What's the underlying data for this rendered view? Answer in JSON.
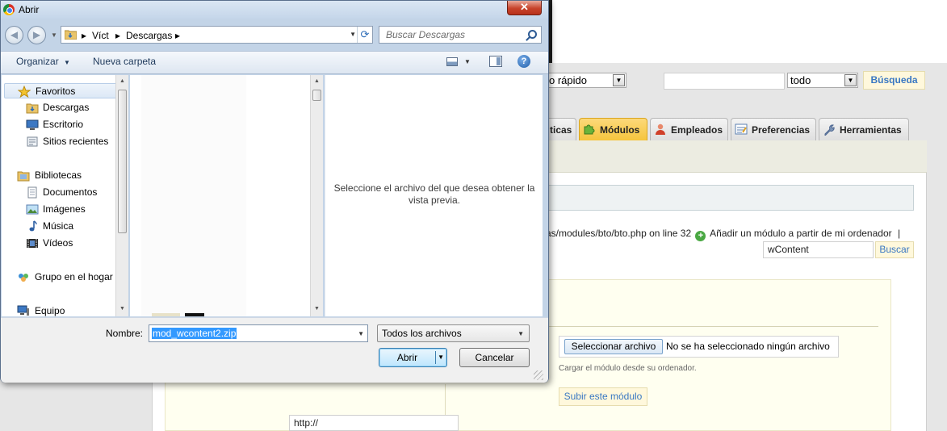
{
  "background_page": {
    "search_mode_select": "o rápido",
    "search_scope_select": "todo",
    "search_button": "Búsqueda",
    "tabs": [
      {
        "label": "ticas",
        "icon": "stats-icon",
        "active": false
      },
      {
        "label": "Módulos",
        "icon": "puzzle-icon",
        "active": true
      },
      {
        "label": "Empleados",
        "icon": "employee-icon",
        "active": false
      },
      {
        "label": "Preferencias",
        "icon": "preferences-icon",
        "active": false
      },
      {
        "label": "Herramientas",
        "icon": "wrench-icon",
        "active": false
      }
    ],
    "error_line_text": "as/modules/bto/bto.php on line 32",
    "add_module_link": "Añadir un módulo a partir de mi ordenador",
    "separator": "|",
    "module_search_value": "wContent",
    "module_search_button": "Buscar",
    "file_select_button": "Seleccionar archivo",
    "file_select_status": "No se ha seleccionado ningún archivo",
    "upload_hint": "Cargar el módulo desde su ordenador.",
    "upload_button": "Subir este módulo",
    "url_field_value": "http://",
    "colors": {
      "active_tab": "#f5c43b",
      "link_blue": "#3a78c3",
      "button_bg": "#fff8dc"
    }
  },
  "dialog": {
    "title": "Abrir",
    "close_label": "✕",
    "breadcrumb": [
      "Víct",
      "Descargas"
    ],
    "search_placeholder": "Buscar Descargas",
    "toolbar": {
      "organize": "Organizar",
      "new_folder": "Nueva carpeta"
    },
    "nav_items": [
      {
        "label": "Favoritos",
        "icon": "star-icon",
        "indent": 0,
        "selected": true
      },
      {
        "label": "Descargas",
        "icon": "downloads-folder-icon",
        "indent": 1,
        "selected": false
      },
      {
        "label": "Escritorio",
        "icon": "desktop-icon",
        "indent": 1,
        "selected": false
      },
      {
        "label": "Sitios recientes",
        "icon": "recent-places-icon",
        "indent": 1,
        "selected": false
      },
      {
        "label": "Bibliotecas",
        "icon": "libraries-icon",
        "indent": 0,
        "selected": false
      },
      {
        "label": "Documentos",
        "icon": "documents-icon",
        "indent": 1,
        "selected": false
      },
      {
        "label": "Imágenes",
        "icon": "pictures-icon",
        "indent": 1,
        "selected": false
      },
      {
        "label": "Música",
        "icon": "music-icon",
        "indent": 1,
        "selected": false
      },
      {
        "label": "Vídeos",
        "icon": "videos-icon",
        "indent": 1,
        "selected": false
      },
      {
        "label": "Grupo en el hogar",
        "icon": "homegroup-icon",
        "indent": 0,
        "selected": false
      },
      {
        "label": "Equipo",
        "icon": "computer-icon",
        "indent": 0,
        "selected": false
      }
    ],
    "preview_message": "Seleccione el archivo del que desea obtener la vista previa.",
    "filename_label": "Nombre:",
    "filename_value": "mod_wcontent2.zip",
    "filetype_value": "Todos los archivos",
    "open_button": "Abrir",
    "cancel_button": "Cancelar"
  }
}
